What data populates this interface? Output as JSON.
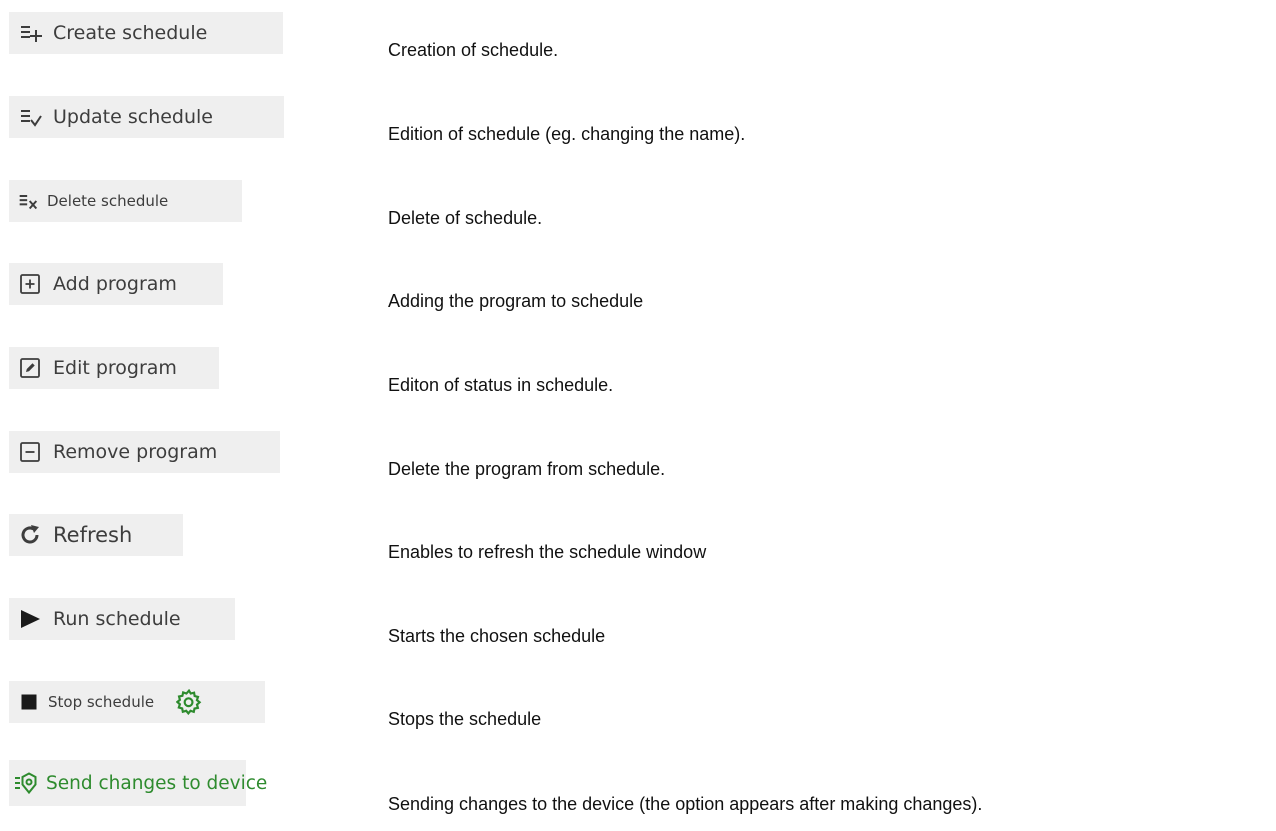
{
  "entries": [
    {
      "icon": "create-list-icon",
      "label": "Create schedule",
      "description": "Creation of schedule."
    },
    {
      "icon": "update-list-icon",
      "label": "Update schedule",
      "description": "Edition of schedule (eg. changing the name)."
    },
    {
      "icon": "delete-list-icon",
      "label": "Delete schedule",
      "description": "Delete of schedule."
    },
    {
      "icon": "add-box-icon",
      "label": "Add program",
      "description": "Adding the program to schedule"
    },
    {
      "icon": "edit-box-icon",
      "label": "Edit program",
      "description": "Editon of status in schedule."
    },
    {
      "icon": "remove-box-icon",
      "label": "Remove program",
      "description": "Delete the program from schedule."
    },
    {
      "icon": "refresh-icon",
      "label": "Refresh",
      "description": "Enables to refresh the schedule window"
    },
    {
      "icon": "play-icon",
      "label": "Run schedule",
      "description": "Starts the chosen schedule"
    },
    {
      "icon": "stop-icon",
      "label": "Stop schedule",
      "description": "Stops the schedule",
      "extra_icon": "gear-icon"
    },
    {
      "icon": "send-device-icon",
      "label": "Send changes to device",
      "description": "Sending changes to the device (the option appears after making changes)."
    }
  ],
  "colors": {
    "button_bg": "#efefef",
    "button_text": "#3d3d3d",
    "accent_green": "#2e8b2e",
    "description_text": "#111111"
  }
}
